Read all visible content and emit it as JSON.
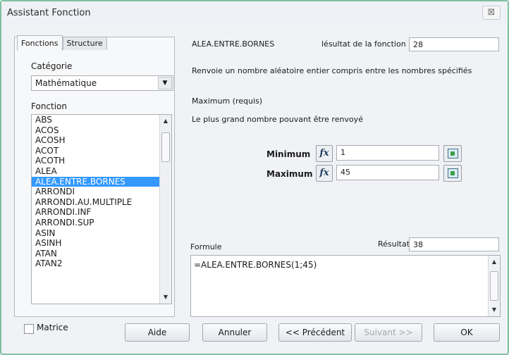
{
  "window": {
    "title": "Assistant Fonction",
    "close_glyph": "⊠"
  },
  "tabs": [
    {
      "label": "Fonctions"
    },
    {
      "label": "Structure"
    }
  ],
  "left": {
    "category_label": "Catégorie",
    "category_value": "Mathématique",
    "function_label": "Fonction",
    "functions": [
      "ABS",
      "ACOS",
      "ACOSH",
      "ACOT",
      "ACOTH",
      "ALEA",
      "ALEA.ENTRE.BORNES",
      "ARRONDI",
      "ARRONDI.AU.MULTIPLE",
      "ARRONDI.INF",
      "ARRONDI.SUP",
      "ASIN",
      "ASINH",
      "ATAN",
      "ATAN2"
    ],
    "selected_index": 6
  },
  "right": {
    "function_name": "ALEA.ENTRE.BORNES",
    "result_label": "lésultat de la fonction",
    "result_value": "28",
    "description": "Renvoie un nombre aléatoire entier compris entre les nombres spécifiés",
    "param_title": "Maximum (requis)",
    "param_description": "Le plus grand nombre pouvant être renvoyé",
    "args": [
      {
        "label": "Minimum",
        "value": "1"
      },
      {
        "label": "Maximum",
        "value": "45"
      }
    ],
    "fx_label": "fx",
    "formula_label": "Formule",
    "result2_label": "Résultat",
    "result2_value": "38",
    "formula_text": "=ALEA.ENTRE.BORNES(1;45)"
  },
  "footer": {
    "matrix_label": "Matrice",
    "help": "Aide",
    "cancel": "Annuler",
    "previous": "<< Précédent",
    "next": "Suivant >>",
    "ok": "OK"
  }
}
